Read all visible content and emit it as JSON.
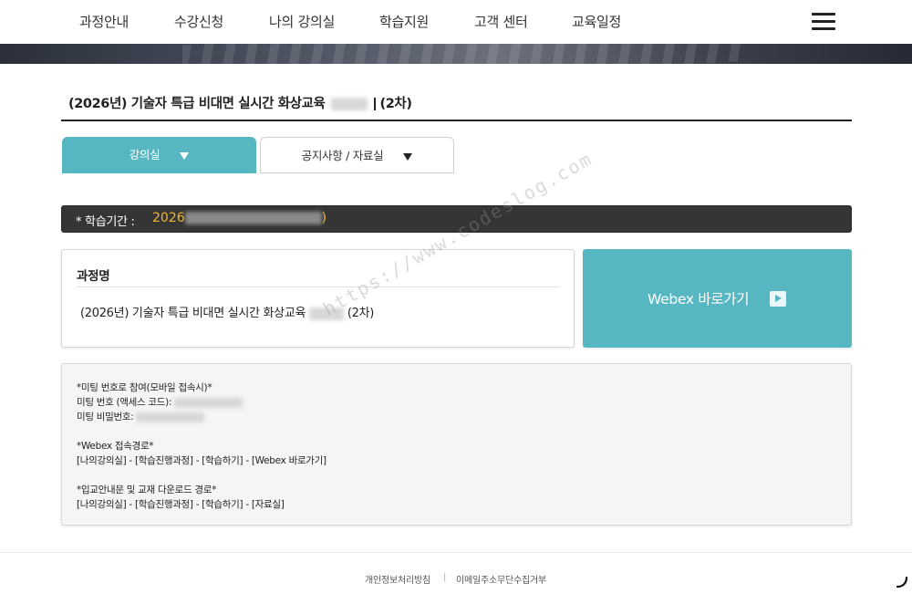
{
  "nav": {
    "items": [
      "과정안내",
      "수강신청",
      "나의 강의실",
      "학습지원",
      "고객 센터",
      "교육일정"
    ]
  },
  "course": {
    "title_prefix": "(2026년) 기술자 특급 비대면 실시간 화상교육",
    "title_suffix": "(2차)"
  },
  "tabs": {
    "classroom": "강의실",
    "notice": "공지사항 / 자료실"
  },
  "period": {
    "label": "* 학습기간 :",
    "value_prefix": "2026",
    "value_suffix": ")"
  },
  "card": {
    "heading": "과정명",
    "name_prefix": "(2026년) 기술자 특급 비대면 실시간 화상교육",
    "name_suffix": "(2차)"
  },
  "webex": {
    "label": "Webex 바로가기"
  },
  "info": {
    "meeting_join": "*미팅 번호로 참여(모바일 접속시)*",
    "meeting_number_label": "미팅 번호 (액세스 코드):",
    "meeting_password_label": "미팅 비밀번호:",
    "webex_path_title": "*Webex 접속경로*",
    "webex_path": "[나의강의실] - [학습진행과정] - [학습하기] - [Webex 바로가기]",
    "download_title": "*입교안내문 및 교재 다운로드 경로*",
    "download_path": "[나의강의실] - [학습진행과정] - [학습하기] - [자료실]"
  },
  "watermark": "https://www.codeslog.com",
  "footer": {
    "privacy": "개인정보처리방침",
    "no_email": "이메일주소무단수집거부",
    "separator": "|"
  },
  "colors": {
    "accent": "#56b7c3",
    "period_bar": "#353535",
    "period_value": "#f2b531"
  }
}
